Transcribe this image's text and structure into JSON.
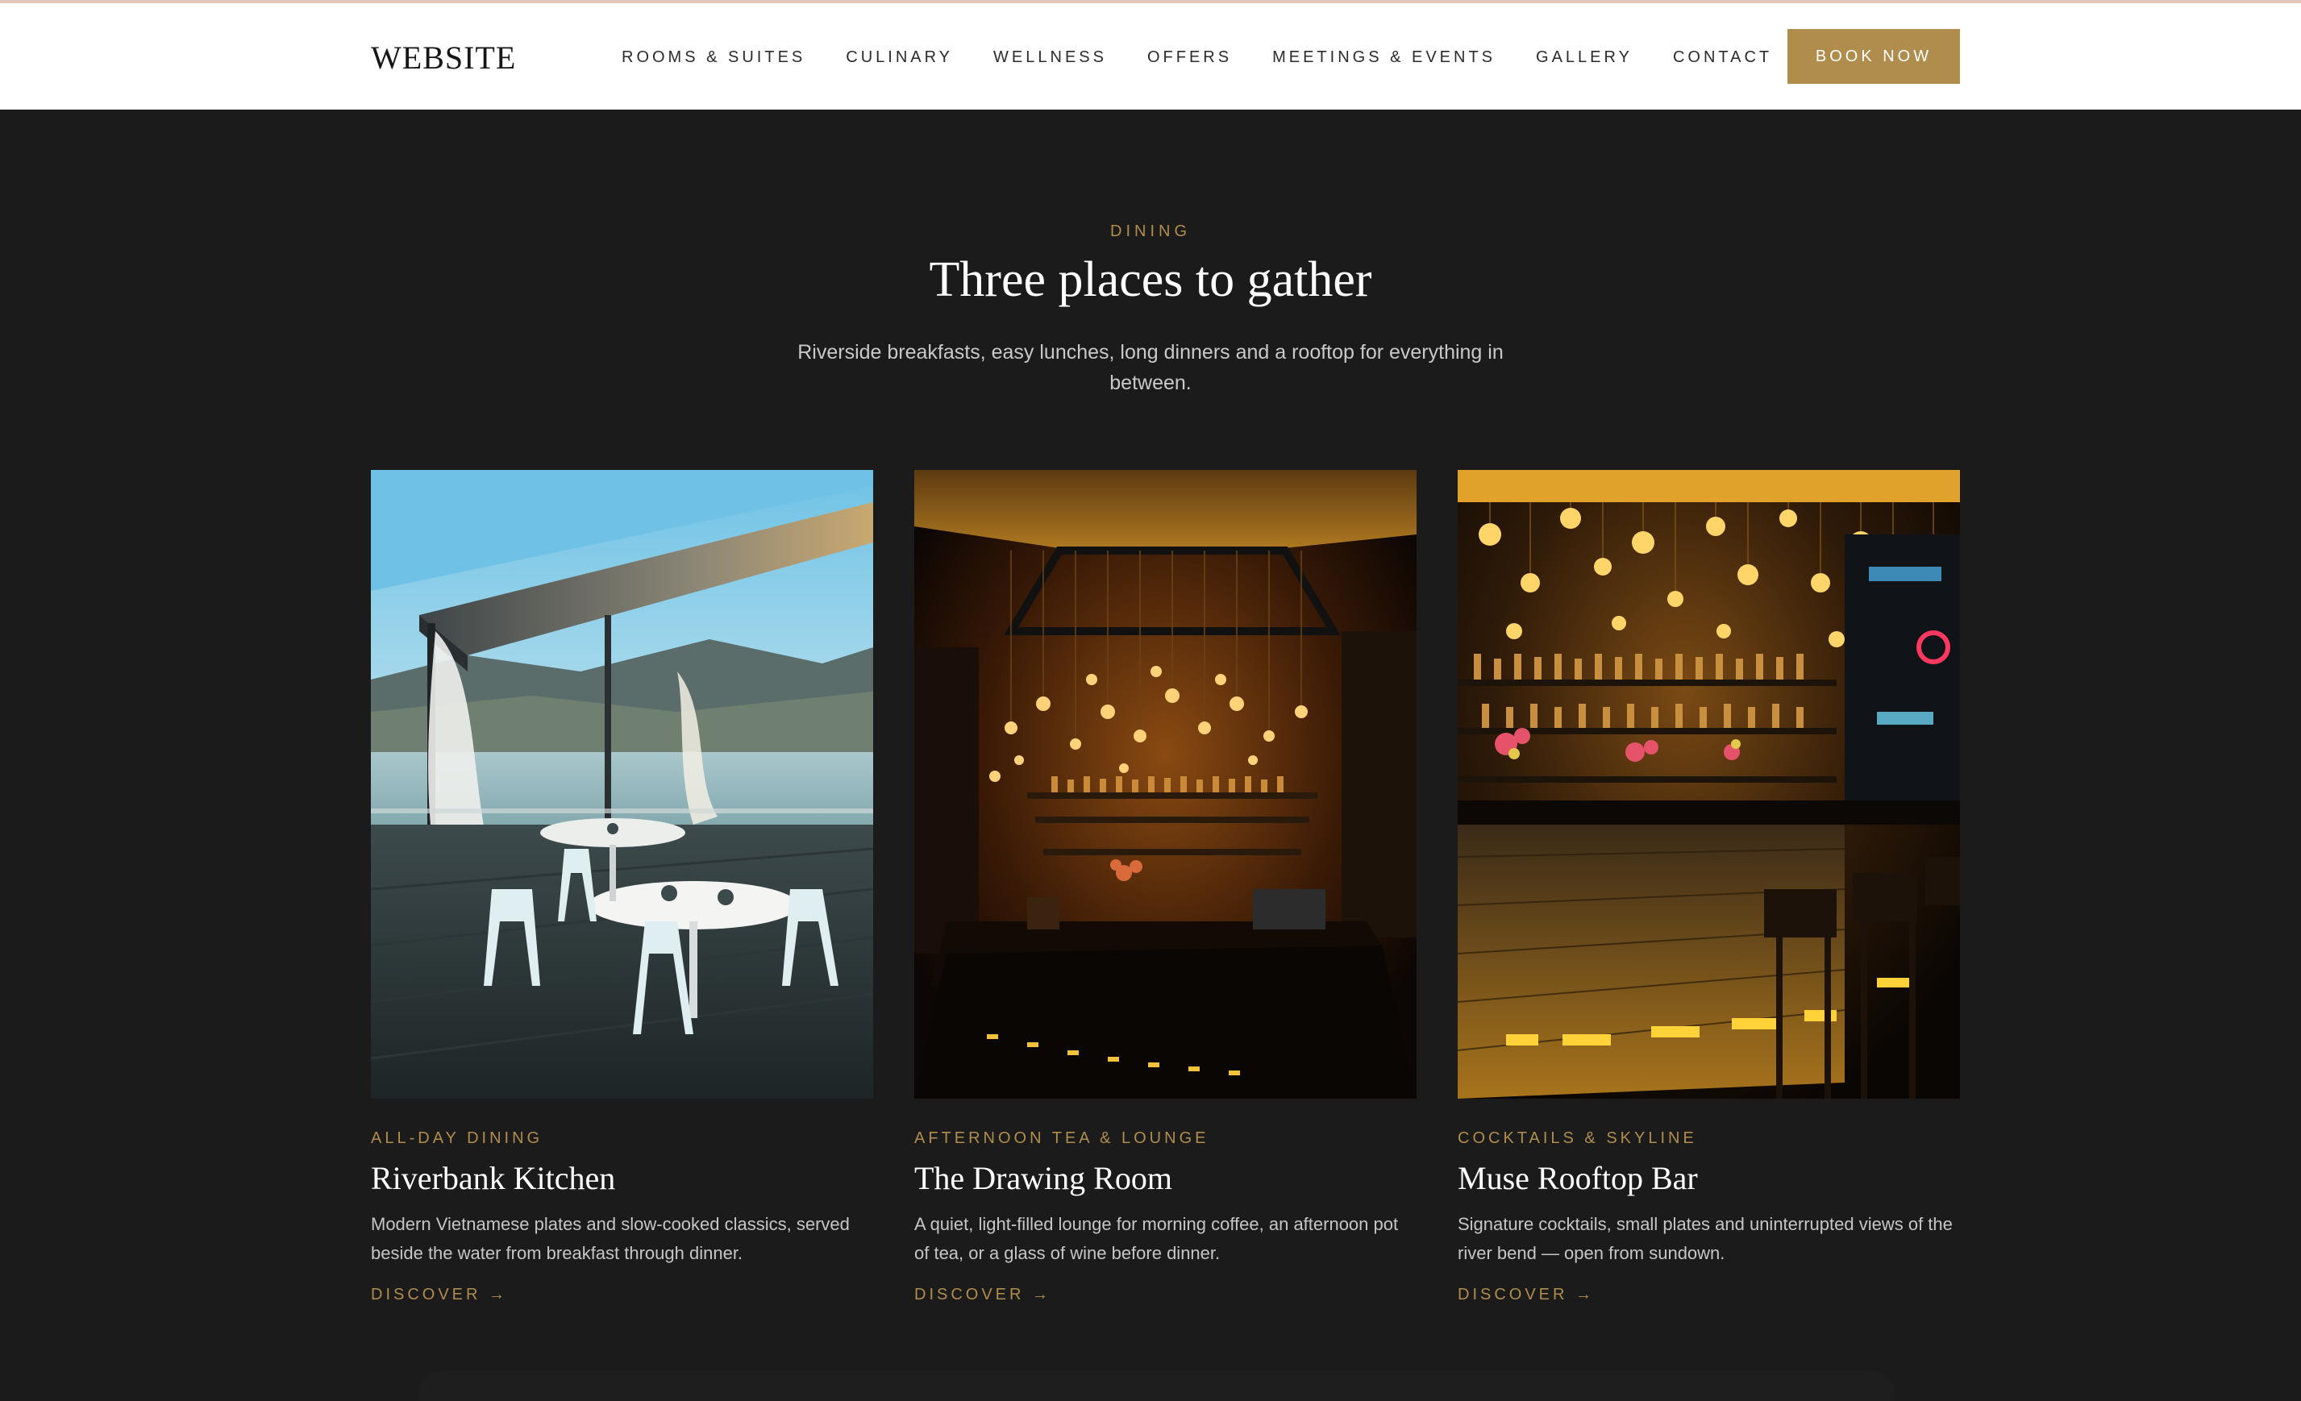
{
  "header": {
    "logo": "WEBSITE",
    "nav": [
      "ROOMS & SUITES",
      "CULINARY",
      "WELLNESS",
      "OFFERS",
      "MEETINGS & EVENTS",
      "GALLERY",
      "CONTACT"
    ],
    "cta": "BOOK NOW"
  },
  "intro": {
    "eyebrow": "DINING",
    "title": "Three places to gather",
    "subtitle": "Riverside breakfasts, easy lunches, long dinners and a rooftop for everything in between."
  },
  "cards": [
    {
      "kicker": "ALL-DAY DINING",
      "title": "Riverbank Kitchen",
      "desc": "Modern Vietnamese plates and slow-cooked classics, served beside the water from breakfast through dinner.",
      "link": "DISCOVER →"
    },
    {
      "kicker": "AFTERNOON TEA & LOUNGE",
      "title": "The Drawing Room",
      "desc": "A quiet, light-filled lounge for morning coffee, an afternoon pot of tea, or a glass of wine before dinner.",
      "link": "DISCOVER →"
    },
    {
      "kicker": "COCKTAILS & SKYLINE",
      "title": "Muse Rooftop Bar",
      "desc": "Signature cocktails, small plates and uninterrupted views of the river bend — open from sundown.",
      "link": "DISCOVER →"
    }
  ],
  "colors": {
    "accent": "#b08d4d",
    "background": "#1b1b1b",
    "header_bg": "#ffffff"
  }
}
